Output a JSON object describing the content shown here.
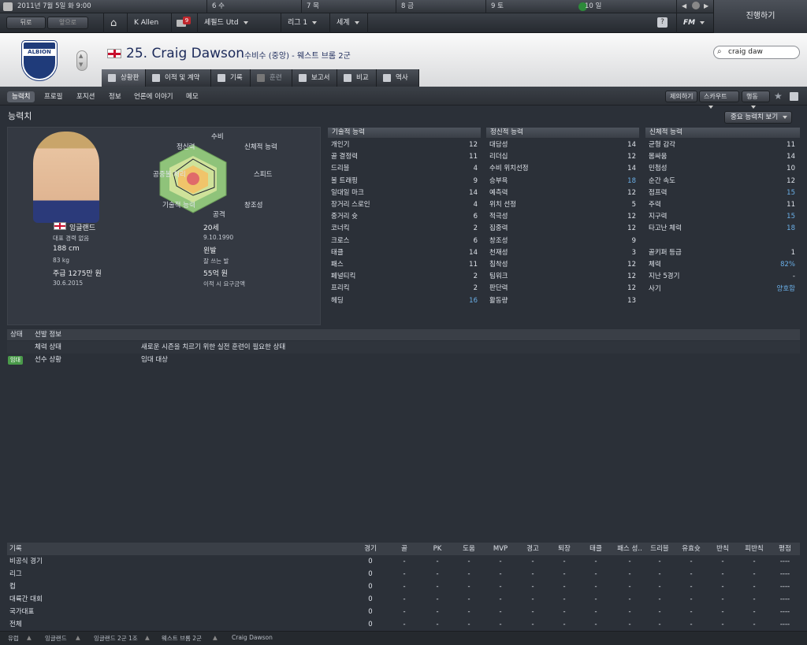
{
  "calendar": {
    "date": "2011년 7월 5일 화 9:00",
    "days": [
      "6 수",
      "7 목",
      "8 금",
      "9 토",
      "10 일"
    ]
  },
  "nav": {
    "back": "뒤로",
    "forward": "앞으로",
    "manager": "K Allen",
    "notifications": "9",
    "club": "셰필드 Utd",
    "league": "리그 1",
    "world": "세계",
    "help": "?",
    "fm": "FM",
    "continue": "진행하기"
  },
  "player": {
    "number_name": "25. Craig Dawson",
    "position_club": "수비수 (중앙) - 웨스트 브롬 2군",
    "crest_text": "ALBION"
  },
  "search": {
    "value": "craig daw"
  },
  "tabs": [
    "상황판",
    "이적 및 계약",
    "기록",
    "훈련",
    "보고서",
    "비교",
    "역사"
  ],
  "subtabs": [
    "능력치",
    "프로필",
    "포지션",
    "정보",
    "언론에 이야기",
    "메모"
  ],
  "actions": {
    "offer": "제의하기",
    "scout": "스카우트",
    "action": "행동"
  },
  "section": {
    "title": "능력치",
    "key_button": "중요 능력치 보기"
  },
  "radar": {
    "labels": [
      "수비",
      "신체적 능력",
      "스피드",
      "창조성",
      "공격",
      "기술적 능력",
      "공중볼 처리",
      "정신력"
    ]
  },
  "bio": {
    "nation": "잉글랜드",
    "caps": "대표 경력 없음",
    "height": "188 cm",
    "weight": "83 kg",
    "wage": "주급 1275만 원",
    "contract": "30.6.2015",
    "age": "20세",
    "dob": "9.10.1990",
    "foot": "왼발",
    "foot_sub": "잘 쓰는 발",
    "value": "55억 원",
    "value_sub": "이적 시 요구금액"
  },
  "technical": {
    "title": "기술적 능력",
    "rows": [
      [
        "개인기",
        "12"
      ],
      [
        "골 결정력",
        "11"
      ],
      [
        "드리블",
        "4"
      ],
      [
        "볼 트래핑",
        "9"
      ],
      [
        "일대일 마크",
        "14"
      ],
      [
        "장거리 스로인",
        "4"
      ],
      [
        "중거리 슛",
        "6"
      ],
      [
        "코너킥",
        "2"
      ],
      [
        "크로스",
        "6"
      ],
      [
        "태클",
        "14"
      ],
      [
        "패스",
        "11"
      ],
      [
        "페널티킥",
        "2"
      ],
      [
        "프리킥",
        "2"
      ],
      [
        "헤딩",
        "16"
      ]
    ]
  },
  "mental": {
    "title": "정신적 능력",
    "rows": [
      [
        "대담성",
        "14"
      ],
      [
        "리더십",
        "12"
      ],
      [
        "수비 위치선정",
        "14"
      ],
      [
        "승부욕",
        "18"
      ],
      [
        "예측력",
        "12"
      ],
      [
        "위치 선정",
        "5"
      ],
      [
        "적극성",
        "12"
      ],
      [
        "집중력",
        "12"
      ],
      [
        "창조성",
        "9"
      ],
      [
        "천재성",
        "3"
      ],
      [
        "침착성",
        "12"
      ],
      [
        "팀워크",
        "12"
      ],
      [
        "판단력",
        "12"
      ],
      [
        "활동량",
        "13"
      ]
    ]
  },
  "physical": {
    "title": "신체적 능력",
    "rows": [
      [
        "균형 감각",
        "11"
      ],
      [
        "몸싸움",
        "14"
      ],
      [
        "민첩성",
        "10"
      ],
      [
        "순간 속도",
        "12"
      ],
      [
        "점프력",
        "15"
      ],
      [
        "주력",
        "11"
      ],
      [
        "지구력",
        "15"
      ],
      [
        "타고난 체력",
        "18"
      ]
    ],
    "extra": [
      [
        "골키퍼 등급",
        "1"
      ],
      [
        "체력",
        "82%"
      ],
      [
        "지난 5경기",
        "-"
      ],
      [
        "사기",
        "양호함"
      ]
    ]
  },
  "info": {
    "head_status": "상태",
    "head_info": "선발 정보",
    "rows": [
      {
        "badge": "",
        "label": "체력 상태",
        "text": "새로운 시즌을 치르기 위한 실전 훈련이 필요한 상태"
      },
      {
        "badge": "임대",
        "label": "선수 상황",
        "text": "임대 대상"
      }
    ]
  },
  "stats": {
    "headers": [
      "기록",
      "경기",
      "골",
      "PK",
      "도움",
      "MVP",
      "경고",
      "퇴장",
      "태클",
      "패스 성..",
      "드리블",
      "유효슛",
      "반칙",
      "피반칙",
      "평점"
    ],
    "rows": [
      [
        "비공식 경기",
        "0",
        "-",
        "-",
        "-",
        "-",
        "-",
        "-",
        "-",
        "-",
        "-",
        "-",
        "-",
        "-",
        "----"
      ],
      [
        "리그",
        "0",
        "-",
        "-",
        "-",
        "-",
        "-",
        "-",
        "-",
        "-",
        "-",
        "-",
        "-",
        "-",
        "----"
      ],
      [
        "컵",
        "0",
        "-",
        "-",
        "-",
        "-",
        "-",
        "-",
        "-",
        "-",
        "-",
        "-",
        "-",
        "-",
        "----"
      ],
      [
        "대륙간 대회",
        "0",
        "-",
        "-",
        "-",
        "-",
        "-",
        "-",
        "-",
        "-",
        "-",
        "-",
        "-",
        "-",
        "----"
      ],
      [
        "국가대표",
        "0",
        "-",
        "-",
        "-",
        "-",
        "-",
        "-",
        "-",
        "-",
        "-",
        "-",
        "-",
        "-",
        "----"
      ],
      [
        "전체",
        "0",
        "-",
        "-",
        "-",
        "-",
        "-",
        "-",
        "-",
        "-",
        "-",
        "-",
        "-",
        "-",
        "----"
      ]
    ]
  },
  "footer": {
    "crumbs": [
      "유럽",
      "잉글랜드",
      "잉글랜드 2군 1조",
      "웨스트 브롬 2군",
      "Craig Dawson"
    ]
  },
  "colors": {
    "highlight": "#6aaee6",
    "header_text": "#1c2a5a",
    "badge": "#4a9a4a"
  }
}
